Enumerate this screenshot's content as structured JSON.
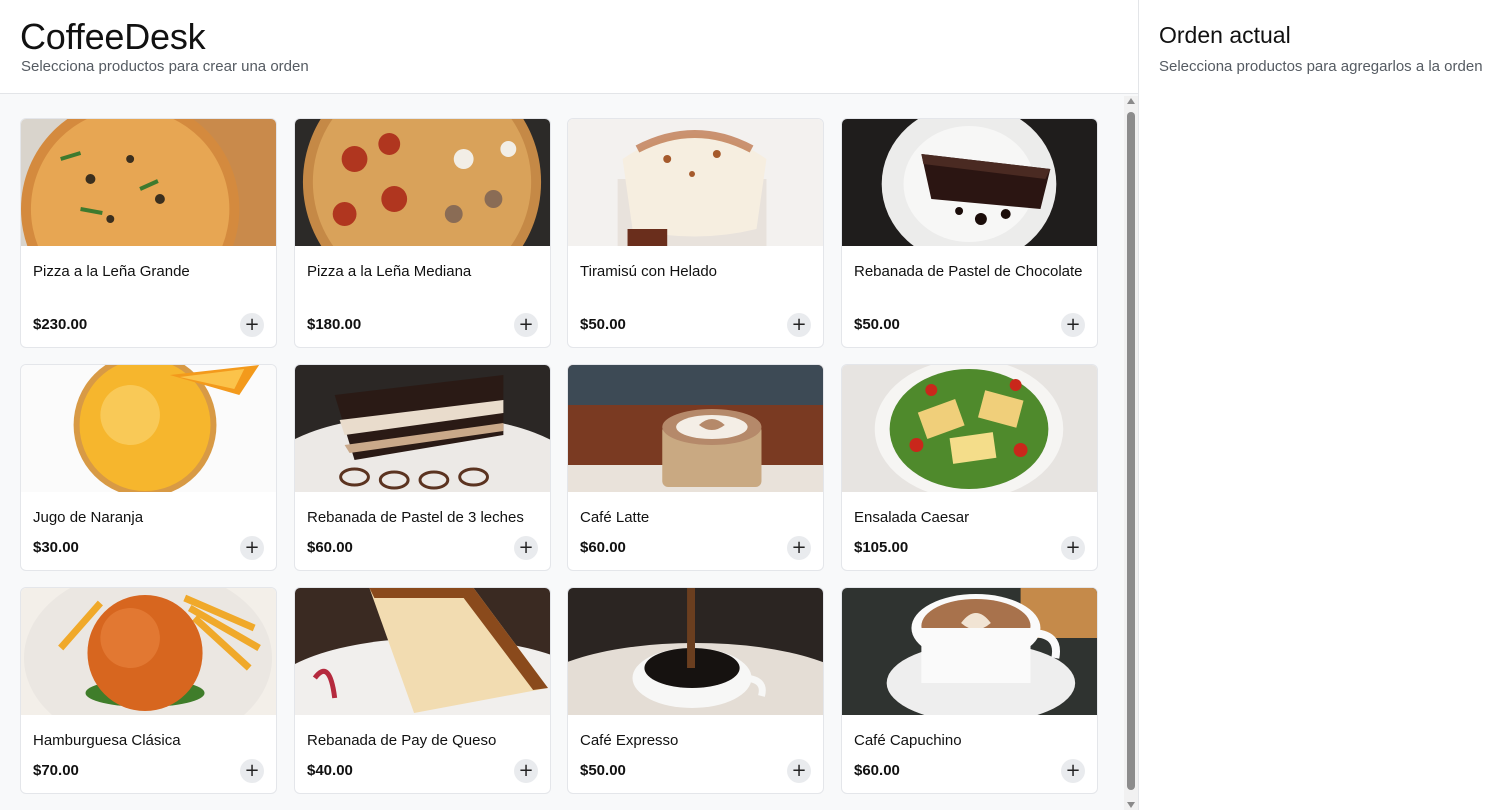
{
  "header": {
    "title": "CoffeeDesk",
    "subtitle": "Selecciona productos para crear una orden"
  },
  "order": {
    "title": "Orden actual",
    "subtitle": "Selecciona productos para agregarlos a la orden"
  },
  "add_button_label": "+",
  "products": [
    {
      "name": "Pizza a la Leña Grande",
      "price": "$230.00",
      "image": "pizza-image"
    },
    {
      "name": "Pizza a la Leña Mediana",
      "price": "$180.00",
      "image": "pizza-pepperoni-image"
    },
    {
      "name": "Tiramisú con Helado",
      "price": "$50.00",
      "image": "tiramisu-image"
    },
    {
      "name": "Rebanada de Pastel de Chocolate",
      "price": "$50.00",
      "image": "chocolate-cake-image"
    },
    {
      "name": "Jugo de Naranja",
      "price": "$30.00",
      "image": "orange-juice-image"
    },
    {
      "name": "Rebanada de Pastel de 3 leches",
      "price": "$60.00",
      "image": "three-milk-cake-image"
    },
    {
      "name": "Café Latte",
      "price": "$60.00",
      "image": "latte-image"
    },
    {
      "name": "Ensalada Caesar",
      "price": "$105.00",
      "image": "caesar-salad-image"
    },
    {
      "name": "Hamburguesa Clásica",
      "price": "$70.00",
      "image": "burger-image"
    },
    {
      "name": "Rebanada de Pay de Queso",
      "price": "$40.00",
      "image": "cheesecake-image"
    },
    {
      "name": "Café Expresso",
      "price": "$50.00",
      "image": "espresso-image"
    },
    {
      "name": "Café Capuchino",
      "price": "$60.00",
      "image": "cappuccino-image"
    }
  ]
}
